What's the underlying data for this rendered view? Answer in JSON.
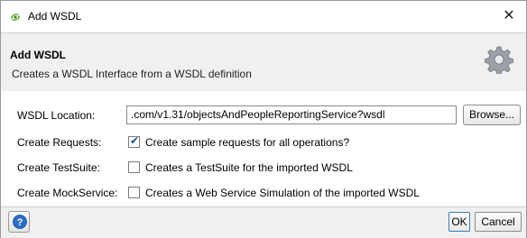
{
  "window": {
    "title": "Add WSDL",
    "close_label": "✕"
  },
  "header": {
    "title": "Add WSDL",
    "description": "Creates a WSDL Interface from a WSDL definition"
  },
  "form": {
    "wsdl_location_label": "WSDL Location:",
    "wsdl_location_value": ".com/v1.31/objectsAndPeopleReportingService?wsdl",
    "browse_label": "Browse...",
    "create_requests": {
      "label": "Create Requests:",
      "checked": true,
      "text": "Create sample requests for all operations?"
    },
    "create_testsuite": {
      "label": "Create TestSuite:",
      "checked": false,
      "text": "Creates a TestSuite for the imported WSDL"
    },
    "create_mockservice": {
      "label": "Create MockService:",
      "checked": false,
      "text": "Creates a Web Service Simulation of the imported WSDL"
    }
  },
  "footer": {
    "ok_label": "OK",
    "cancel_label": "Cancel"
  },
  "icons": {
    "app": "soapui-logo-icon",
    "gear": "gear-icon",
    "help": "help-icon"
  },
  "colors": {
    "accent": "#1a4c9c",
    "help_blue": "#2a6fc9",
    "logo_green": "#5aa832"
  }
}
